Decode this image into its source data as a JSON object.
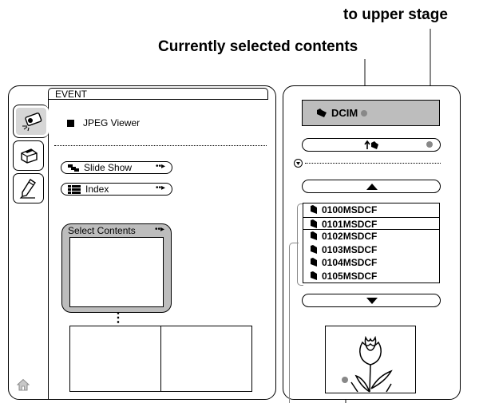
{
  "callouts": {
    "upper_stage": "to upper stage",
    "current": "Currently selected contents"
  },
  "left_panel": {
    "tab_title": "EVENT",
    "viewer_label": "JPEG Viewer",
    "slide_show_label": "Slide Show",
    "index_label": "Index",
    "select_contents_label": "Select Contents",
    "arrow_glyph": "••▸",
    "ellipsis": "⋮"
  },
  "right_panel": {
    "current_folder": "DCIM",
    "folders": [
      "0100MSDCF",
      "0101MSDCF",
      "0102MSDCF",
      "0103MSDCF",
      "0104MSDCF",
      "0105MSDCF"
    ],
    "selected_folder_index": 1
  },
  "icons": {
    "side_tabs": [
      "projector-icon",
      "printer-icon",
      "pen-icon"
    ],
    "home": "home-icon",
    "folder": "folder-icon"
  }
}
